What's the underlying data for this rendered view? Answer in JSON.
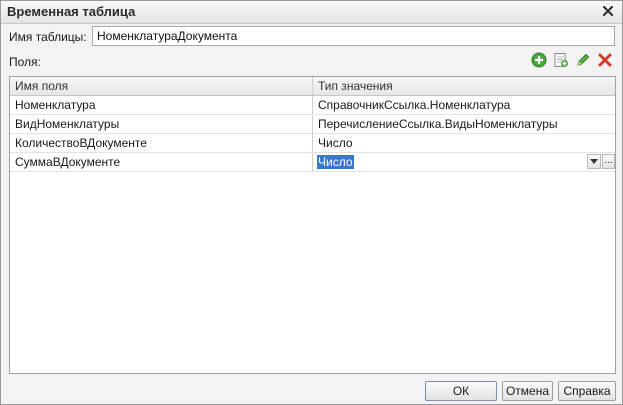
{
  "window": {
    "title": "Временная таблица",
    "close_icon": "close-icon"
  },
  "form": {
    "table_name_label": "Имя таблицы:",
    "table_name_value": "НоменклатураДокумента",
    "fields_label": "Поля:"
  },
  "toolbar": {
    "icons": [
      "add-icon",
      "copy-icon",
      "edit-icon",
      "delete-icon"
    ]
  },
  "table": {
    "columns": [
      "Имя поля",
      "Тип значения"
    ],
    "rows": [
      {
        "name": "Номенклатура",
        "type": "СправочникСсылка.Номенклатура"
      },
      {
        "name": "ВидНоменклатуры",
        "type": "ПеречислениеСсылка.ВидыНоменклатуры"
      },
      {
        "name": "КоличествоВДокументе",
        "type": "Число"
      },
      {
        "name": "СуммаВДокументе",
        "type": "Число"
      }
    ],
    "active_row": 3,
    "edit_ellipsis": "..."
  },
  "buttons": {
    "ok": "ОК",
    "cancel": "Отмена",
    "help": "Справка"
  },
  "colors": {
    "selection": "#3875d7",
    "add_green": "#4aa83c",
    "delete_red": "#d23a2a"
  }
}
